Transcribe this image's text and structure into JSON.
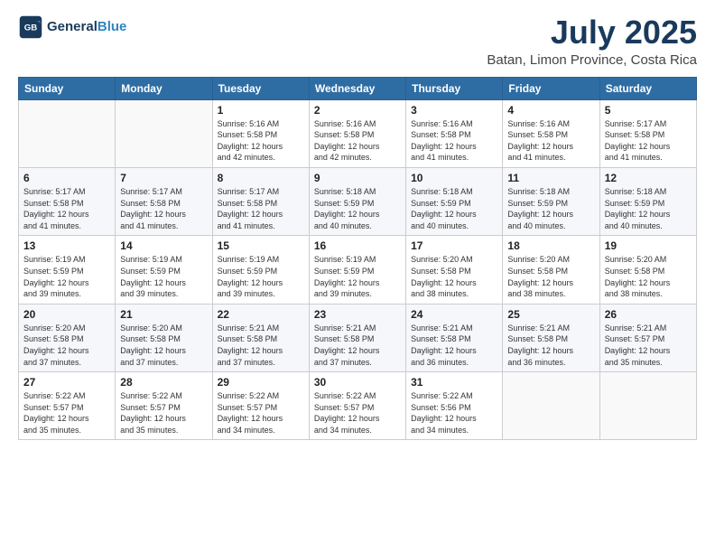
{
  "header": {
    "logo_line1": "General",
    "logo_line2": "Blue",
    "month_year": "July 2025",
    "location": "Batan, Limon Province, Costa Rica"
  },
  "days_of_week": [
    "Sunday",
    "Monday",
    "Tuesday",
    "Wednesday",
    "Thursday",
    "Friday",
    "Saturday"
  ],
  "weeks": [
    [
      {
        "day": "",
        "info": ""
      },
      {
        "day": "",
        "info": ""
      },
      {
        "day": "1",
        "info": "Sunrise: 5:16 AM\nSunset: 5:58 PM\nDaylight: 12 hours\nand 42 minutes."
      },
      {
        "day": "2",
        "info": "Sunrise: 5:16 AM\nSunset: 5:58 PM\nDaylight: 12 hours\nand 42 minutes."
      },
      {
        "day": "3",
        "info": "Sunrise: 5:16 AM\nSunset: 5:58 PM\nDaylight: 12 hours\nand 41 minutes."
      },
      {
        "day": "4",
        "info": "Sunrise: 5:16 AM\nSunset: 5:58 PM\nDaylight: 12 hours\nand 41 minutes."
      },
      {
        "day": "5",
        "info": "Sunrise: 5:17 AM\nSunset: 5:58 PM\nDaylight: 12 hours\nand 41 minutes."
      }
    ],
    [
      {
        "day": "6",
        "info": "Sunrise: 5:17 AM\nSunset: 5:58 PM\nDaylight: 12 hours\nand 41 minutes."
      },
      {
        "day": "7",
        "info": "Sunrise: 5:17 AM\nSunset: 5:58 PM\nDaylight: 12 hours\nand 41 minutes."
      },
      {
        "day": "8",
        "info": "Sunrise: 5:17 AM\nSunset: 5:58 PM\nDaylight: 12 hours\nand 41 minutes."
      },
      {
        "day": "9",
        "info": "Sunrise: 5:18 AM\nSunset: 5:59 PM\nDaylight: 12 hours\nand 40 minutes."
      },
      {
        "day": "10",
        "info": "Sunrise: 5:18 AM\nSunset: 5:59 PM\nDaylight: 12 hours\nand 40 minutes."
      },
      {
        "day": "11",
        "info": "Sunrise: 5:18 AM\nSunset: 5:59 PM\nDaylight: 12 hours\nand 40 minutes."
      },
      {
        "day": "12",
        "info": "Sunrise: 5:18 AM\nSunset: 5:59 PM\nDaylight: 12 hours\nand 40 minutes."
      }
    ],
    [
      {
        "day": "13",
        "info": "Sunrise: 5:19 AM\nSunset: 5:59 PM\nDaylight: 12 hours\nand 39 minutes."
      },
      {
        "day": "14",
        "info": "Sunrise: 5:19 AM\nSunset: 5:59 PM\nDaylight: 12 hours\nand 39 minutes."
      },
      {
        "day": "15",
        "info": "Sunrise: 5:19 AM\nSunset: 5:59 PM\nDaylight: 12 hours\nand 39 minutes."
      },
      {
        "day": "16",
        "info": "Sunrise: 5:19 AM\nSunset: 5:59 PM\nDaylight: 12 hours\nand 39 minutes."
      },
      {
        "day": "17",
        "info": "Sunrise: 5:20 AM\nSunset: 5:58 PM\nDaylight: 12 hours\nand 38 minutes."
      },
      {
        "day": "18",
        "info": "Sunrise: 5:20 AM\nSunset: 5:58 PM\nDaylight: 12 hours\nand 38 minutes."
      },
      {
        "day": "19",
        "info": "Sunrise: 5:20 AM\nSunset: 5:58 PM\nDaylight: 12 hours\nand 38 minutes."
      }
    ],
    [
      {
        "day": "20",
        "info": "Sunrise: 5:20 AM\nSunset: 5:58 PM\nDaylight: 12 hours\nand 37 minutes."
      },
      {
        "day": "21",
        "info": "Sunrise: 5:20 AM\nSunset: 5:58 PM\nDaylight: 12 hours\nand 37 minutes."
      },
      {
        "day": "22",
        "info": "Sunrise: 5:21 AM\nSunset: 5:58 PM\nDaylight: 12 hours\nand 37 minutes."
      },
      {
        "day": "23",
        "info": "Sunrise: 5:21 AM\nSunset: 5:58 PM\nDaylight: 12 hours\nand 37 minutes."
      },
      {
        "day": "24",
        "info": "Sunrise: 5:21 AM\nSunset: 5:58 PM\nDaylight: 12 hours\nand 36 minutes."
      },
      {
        "day": "25",
        "info": "Sunrise: 5:21 AM\nSunset: 5:58 PM\nDaylight: 12 hours\nand 36 minutes."
      },
      {
        "day": "26",
        "info": "Sunrise: 5:21 AM\nSunset: 5:57 PM\nDaylight: 12 hours\nand 35 minutes."
      }
    ],
    [
      {
        "day": "27",
        "info": "Sunrise: 5:22 AM\nSunset: 5:57 PM\nDaylight: 12 hours\nand 35 minutes."
      },
      {
        "day": "28",
        "info": "Sunrise: 5:22 AM\nSunset: 5:57 PM\nDaylight: 12 hours\nand 35 minutes."
      },
      {
        "day": "29",
        "info": "Sunrise: 5:22 AM\nSunset: 5:57 PM\nDaylight: 12 hours\nand 34 minutes."
      },
      {
        "day": "30",
        "info": "Sunrise: 5:22 AM\nSunset: 5:57 PM\nDaylight: 12 hours\nand 34 minutes."
      },
      {
        "day": "31",
        "info": "Sunrise: 5:22 AM\nSunset: 5:56 PM\nDaylight: 12 hours\nand 34 minutes."
      },
      {
        "day": "",
        "info": ""
      },
      {
        "day": "",
        "info": ""
      }
    ]
  ]
}
